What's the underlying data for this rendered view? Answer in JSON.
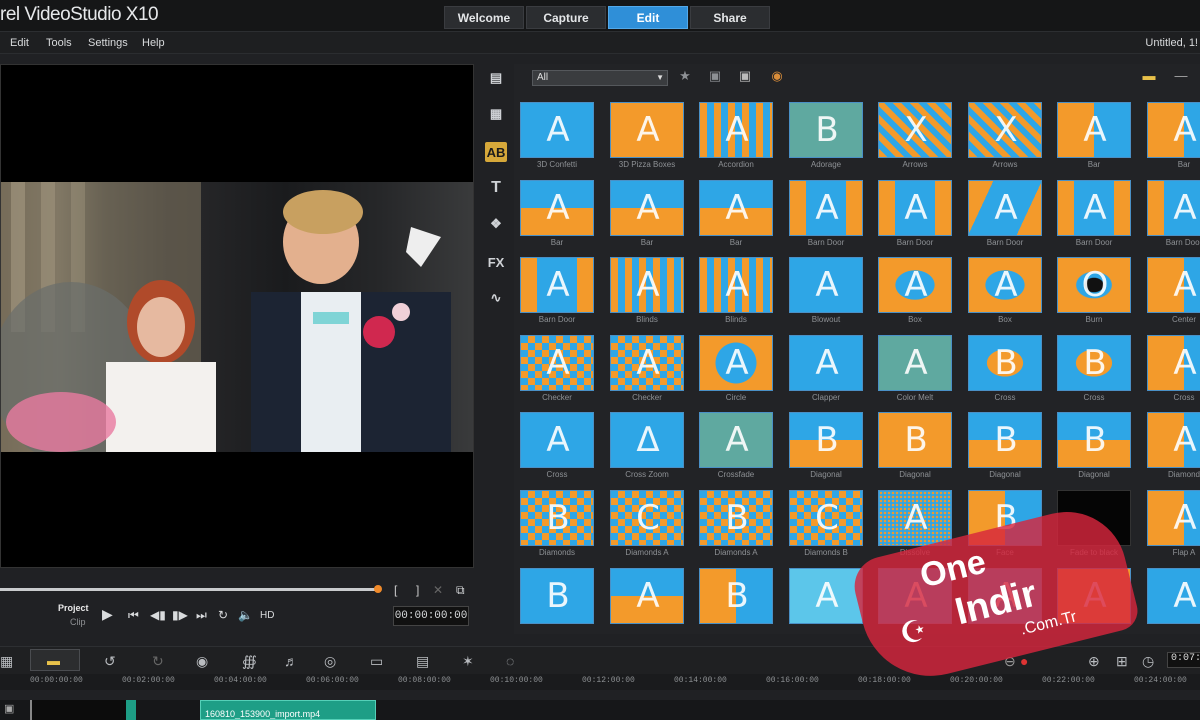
{
  "app": {
    "title": "rel VideoStudio X10",
    "project_name": "Untitled, 1!"
  },
  "tabs": [
    {
      "label": "Welcome"
    },
    {
      "label": "Capture"
    },
    {
      "label": "Edit"
    },
    {
      "label": "Share"
    }
  ],
  "menu": [
    "Edit",
    "Tools",
    "Settings",
    "Help"
  ],
  "player": {
    "mode_project": "Project",
    "mode_clip": "Clip",
    "timecode": "00:00:00:00",
    "hd_label": "HD",
    "progress": 0.79,
    "bracket_in": "[",
    "bracket_out": "]"
  },
  "library": {
    "filter": "All",
    "transitions": [
      {
        "label": "3D Confetti",
        "glyph": "A",
        "style": "confetti"
      },
      {
        "label": "3D Pizza Boxes",
        "glyph": "A",
        "style": "orange"
      },
      {
        "label": "Accordion",
        "glyph": "A",
        "style": "stripes"
      },
      {
        "label": "Adorage",
        "glyph": "B",
        "style": "teal"
      },
      {
        "label": "Arrows",
        "glyph": "X",
        "style": "arrows"
      },
      {
        "label": "Arrows",
        "glyph": "X",
        "style": "arrows"
      },
      {
        "label": "Bar",
        "glyph": "A",
        "style": "halfv"
      },
      {
        "label": "Bar",
        "glyph": "A",
        "style": "halfv"
      },
      {
        "label": "Bar",
        "glyph": "A",
        "style": "halfh"
      },
      {
        "label": "Bar",
        "glyph": "A",
        "style": "halfh"
      },
      {
        "label": "Bar",
        "glyph": "A",
        "style": "halfh"
      },
      {
        "label": "Barn Door",
        "glyph": "A",
        "style": "door"
      },
      {
        "label": "Barn Door",
        "glyph": "A",
        "style": "door"
      },
      {
        "label": "Barn Door",
        "glyph": "A",
        "style": "door2"
      },
      {
        "label": "Barn Door",
        "glyph": "A",
        "style": "door"
      },
      {
        "label": "Barn Door",
        "glyph": "A",
        "style": "door"
      },
      {
        "label": "Barn Door",
        "glyph": "A",
        "style": "door"
      },
      {
        "label": "Blinds",
        "glyph": "A",
        "style": "stripes"
      },
      {
        "label": "Blinds",
        "glyph": "A",
        "style": "stripes"
      },
      {
        "label": "Blowout",
        "glyph": "A",
        "style": "blue"
      },
      {
        "label": "Box",
        "glyph": "A",
        "style": "box"
      },
      {
        "label": "Box",
        "glyph": "A",
        "style": "box"
      },
      {
        "label": "Burn",
        "glyph": "O",
        "style": "burn"
      },
      {
        "label": "Center",
        "glyph": "A",
        "style": "halfv"
      },
      {
        "label": "Checker",
        "glyph": "A",
        "style": "checker"
      },
      {
        "label": "Checker",
        "glyph": "A",
        "style": "checker"
      },
      {
        "label": "Circle",
        "glyph": "A",
        "style": "circle"
      },
      {
        "label": "Clapper",
        "glyph": "A",
        "style": "blue"
      },
      {
        "label": "Color Melt",
        "glyph": "A",
        "style": "teal"
      },
      {
        "label": "Cross",
        "glyph": "B",
        "style": "diamond"
      },
      {
        "label": "Cross",
        "glyph": "B",
        "style": "diamond"
      },
      {
        "label": "Cross",
        "glyph": "A",
        "style": "halfv"
      },
      {
        "label": "Cross",
        "glyph": "A",
        "style": "blue"
      },
      {
        "label": "Cross Zoom",
        "glyph": "Δ",
        "style": "blue"
      },
      {
        "label": "Crossfade",
        "glyph": "A",
        "style": "teal"
      },
      {
        "label": "Diagonal",
        "glyph": "B",
        "style": "halfh"
      },
      {
        "label": "Diagonal",
        "glyph": "B",
        "style": "orange"
      },
      {
        "label": "Diagonal",
        "glyph": "B",
        "style": "halfh"
      },
      {
        "label": "Diagonal",
        "glyph": "B",
        "style": "halfh"
      },
      {
        "label": "Diamond",
        "glyph": "A",
        "style": "halfv"
      },
      {
        "label": "Diamonds",
        "glyph": "B",
        "style": "checker"
      },
      {
        "label": "Diamonds A",
        "glyph": "C",
        "style": "checker"
      },
      {
        "label": "Diamonds A",
        "glyph": "B",
        "style": "checker"
      },
      {
        "label": "Diamonds B",
        "glyph": "C",
        "style": "checker"
      },
      {
        "label": "Dissolve",
        "glyph": "A",
        "style": "dissolve"
      },
      {
        "label": "Face",
        "glyph": "B",
        "style": "halfv"
      },
      {
        "label": "Fade to black",
        "glyph": "",
        "style": "black"
      },
      {
        "label": "Flap A",
        "glyph": "A",
        "style": "halfv"
      },
      {
        "label": "",
        "glyph": "B",
        "style": "blue"
      },
      {
        "label": "",
        "glyph": "A",
        "style": "halfh"
      },
      {
        "label": "",
        "glyph": "B",
        "style": "halfv"
      },
      {
        "label": "",
        "glyph": "A",
        "style": "lightblue"
      },
      {
        "label": "",
        "glyph": "A",
        "style": "blue"
      },
      {
        "label": "",
        "glyph": "A",
        "style": "blue"
      },
      {
        "label": "",
        "glyph": "A",
        "style": "orange"
      },
      {
        "label": "",
        "glyph": "A",
        "style": "blue"
      }
    ]
  },
  "timeline": {
    "ruler": [
      "00:00:00:00",
      "00:02:00:00",
      "00:04:00:00",
      "00:06:00:00",
      "00:08:00:00",
      "00:10:00:00",
      "00:12:00:00",
      "00:14:00:00",
      "00:16:00:00",
      "00:18:00:00",
      "00:20:00:00",
      "00:22:00:00",
      "00:24:00:00"
    ],
    "clip_name": "160810_153900_import.mp4",
    "zoom_timecode": "0:07:"
  },
  "watermark": {
    "line1": "One",
    "line2": "Indir",
    "line3": ".Com.Tr"
  },
  "colors": {
    "accent": "#2f8fd8",
    "orange": "#f39a2b",
    "blue": "#2ea6e6",
    "clip": "#1e9e86"
  }
}
